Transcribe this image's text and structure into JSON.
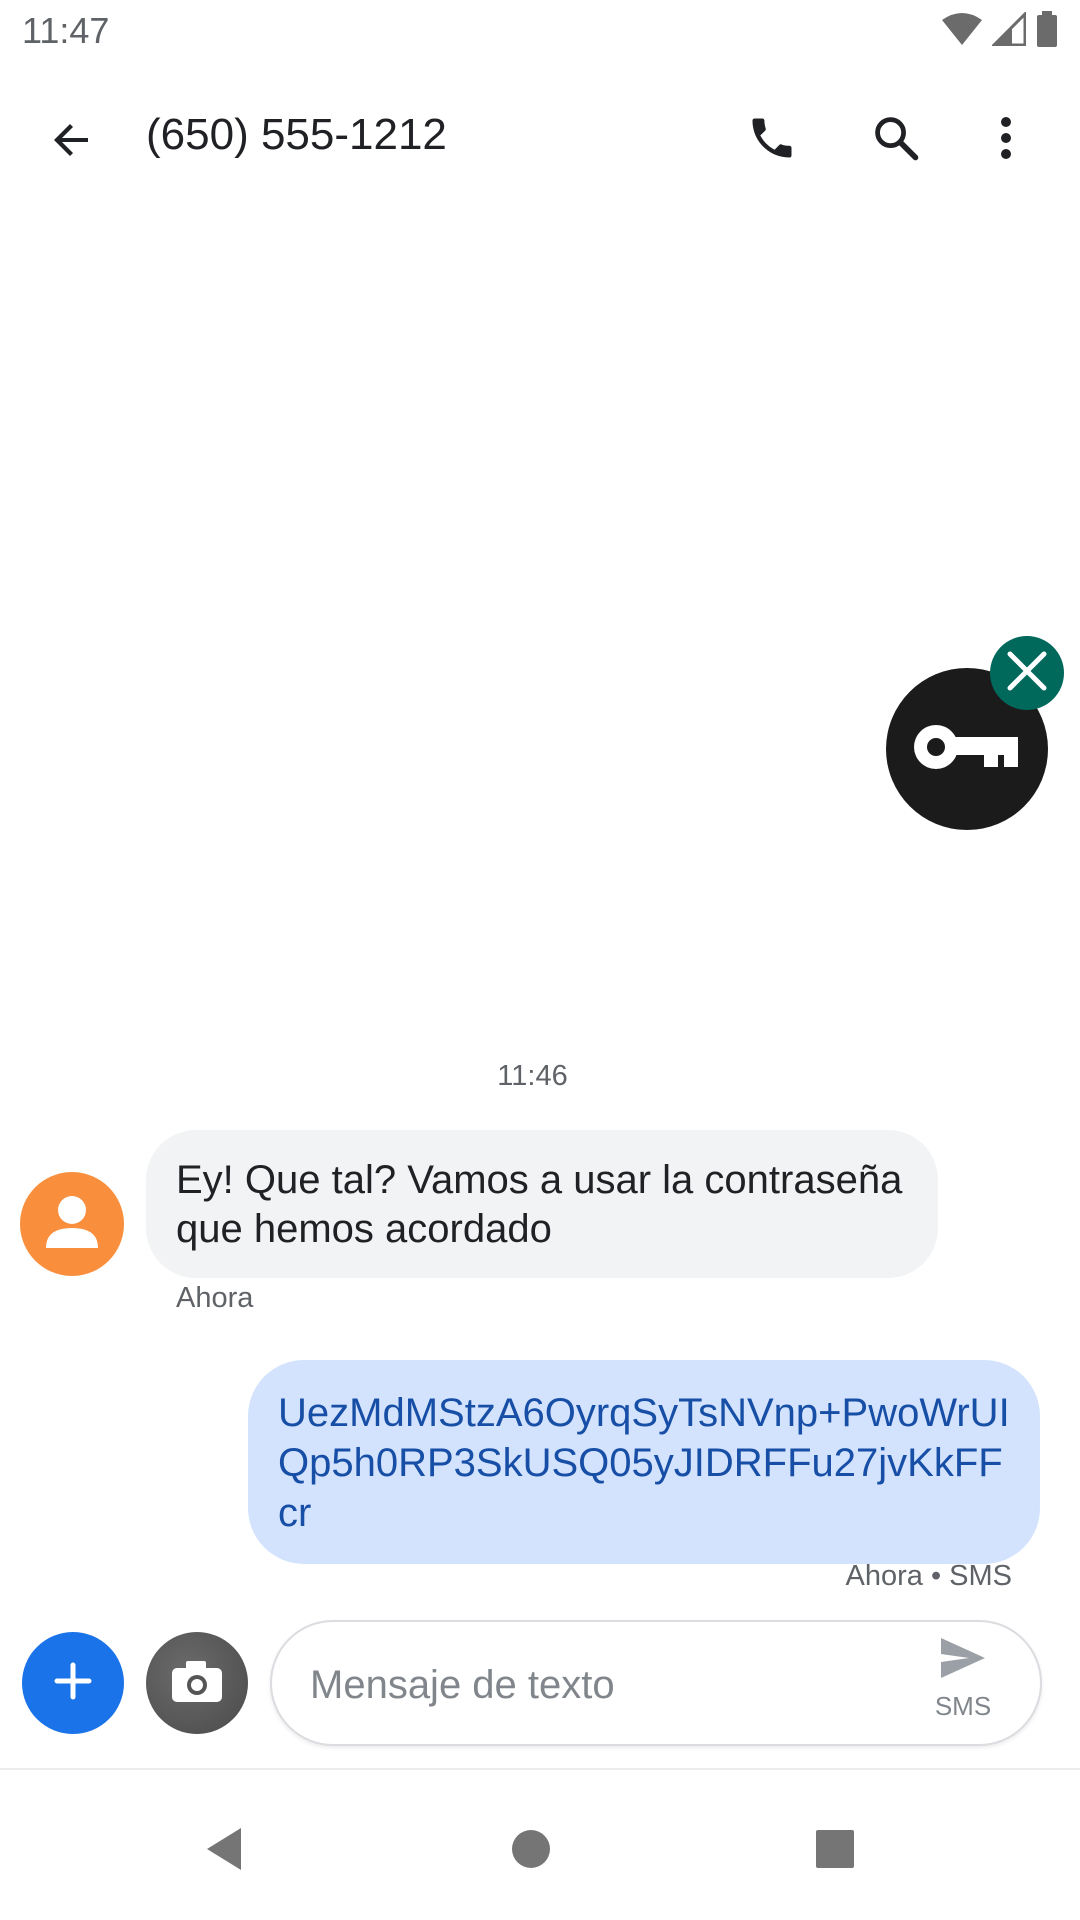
{
  "status_bar": {
    "time": "11:47",
    "icons": [
      "wifi-icon",
      "cell-signal-icon",
      "battery-icon"
    ]
  },
  "app_bar": {
    "title": "(650) 555-1212",
    "icons": {
      "back": "arrow-back-icon",
      "call": "phone-icon",
      "search": "search-icon",
      "more": "more-vert-icon"
    }
  },
  "floating_widget": {
    "icon": "key-icon",
    "close_icon": "close-icon"
  },
  "conversation": {
    "divider_time": "11:46",
    "messages": [
      {
        "direction": "incoming",
        "text": "Ey! Que tal? Vamos a usar la contraseña que hemos acordado",
        "meta": "Ahora"
      },
      {
        "direction": "outgoing",
        "text": "UezMdMStzA6OyrqSyTsNVnp+PwoWrUIQp5h0RP3SkUSQ05yJIDRFFu27jvKkFFcr",
        "meta": "Ahora • SMS"
      }
    ]
  },
  "compose": {
    "placeholder": "Mensaje de texto",
    "value": "",
    "send_label": "SMS"
  },
  "nav_bar": {
    "icons": [
      "nav-back-icon",
      "nav-home-icon",
      "nav-recents-icon"
    ]
  },
  "colors": {
    "accent": "#1a73e8",
    "incoming_bubble": "#f1f3f4",
    "outgoing_bubble": "#d3e3fd",
    "outgoing_text": "#174ea6",
    "avatar": "#f98f3d",
    "key_widget": "#1b1b1b",
    "key_close": "#00695c"
  }
}
